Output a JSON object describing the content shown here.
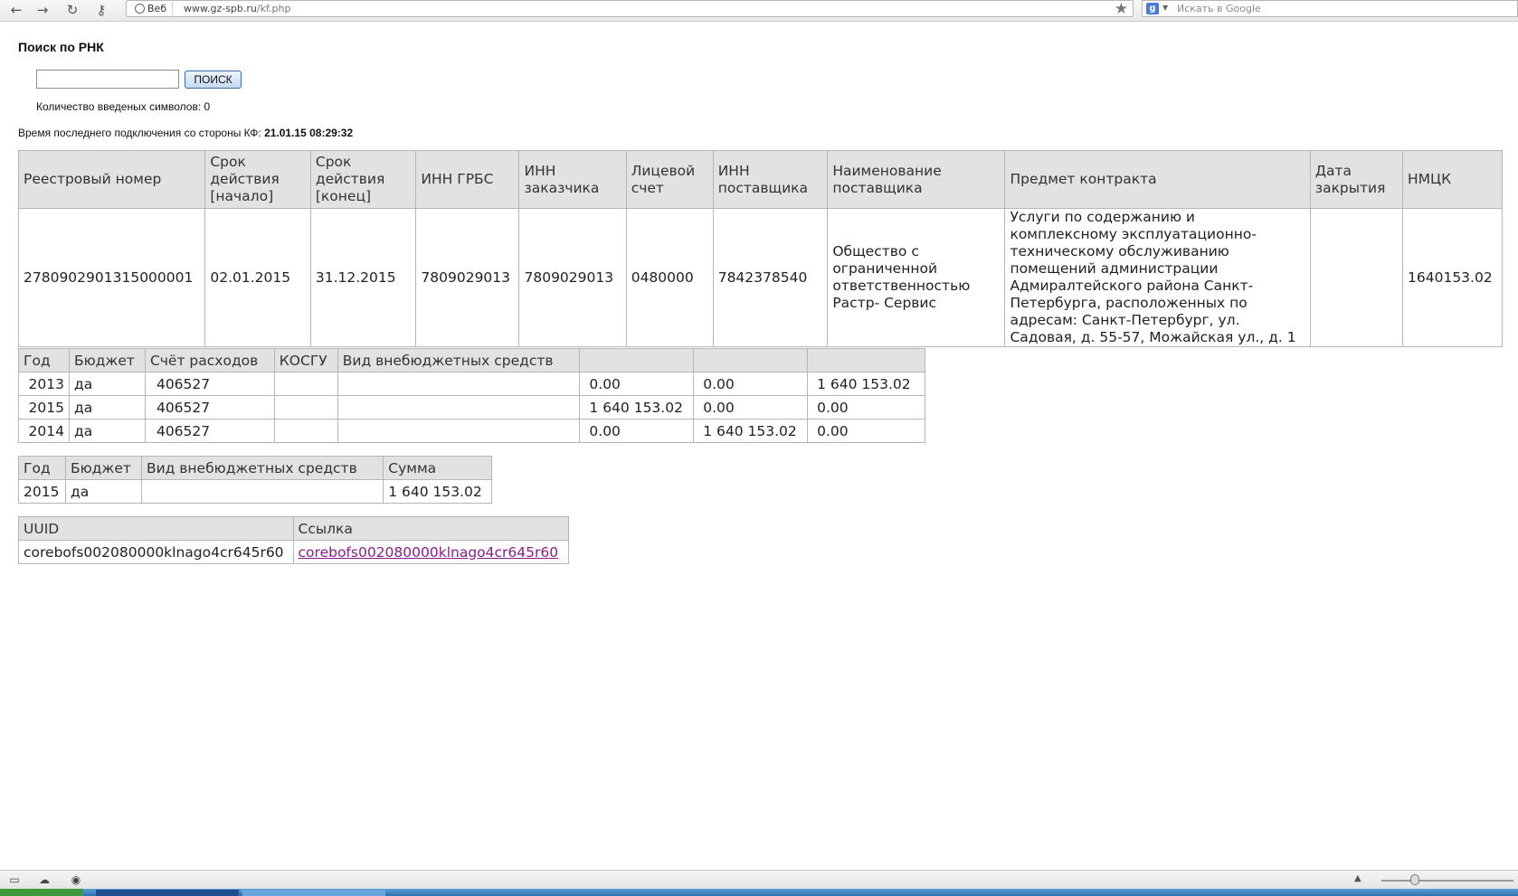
{
  "browser": {
    "back_icon": "←",
    "forward_icon": "→",
    "reload_icon": "↻",
    "key_icon": "⚷",
    "addr_badge": "Веб",
    "url_host": "www.gz-spb.ru",
    "url_path": "/kf.php",
    "star_icon": "★",
    "search_logo": "g",
    "search_placeholder": "Искать в Google"
  },
  "page": {
    "heading": "Поиск по РНК",
    "search_value": "",
    "search_button": "ПОИСК",
    "char_count_label": "Количество введеных символов: 0",
    "last_connection_label": "Время последнего подключения со стороны КФ:",
    "last_connection_value": "21.01.15 08:29:32"
  },
  "contract_table": {
    "headers": [
      "Реестровый номер",
      "Срок действия [начало]",
      "Срок действия [конец]",
      "ИНН ГРБС",
      "ИНН заказчика",
      "Лицевой счет",
      "ИНН поставщика",
      "Наименование поставщика",
      "Предмет контракта",
      "Дата закрытия",
      "НМЦК"
    ],
    "row": [
      "2780902901315000001",
      "02.01.2015",
      "31.12.2015",
      "7809029013",
      "7809029013",
      "0480000",
      "7842378540",
      "Общество с ограниченной ответственностью Растр- Сервис",
      "Услуги по содержанию и комплексному эксплуатационно-техническому обслуживанию помещений администрации Адмиралтейского района Санкт-Петербурга, расположенных по адресам: Санкт-Петербург, ул. Садовая, д. 55-57, Можайская ул., д. 1",
      "",
      "1640153.02"
    ]
  },
  "budget_table": {
    "headers": [
      "Год",
      "Бюджет",
      "Счёт расходов",
      "КОСГУ",
      "Вид внебюджетных средств",
      "",
      "",
      ""
    ],
    "rows": [
      [
        "2013",
        "да",
        "406527",
        "",
        "",
        "0.00",
        "0.00",
        "1 640 153.02"
      ],
      [
        "2015",
        "да",
        "406527",
        "",
        "",
        "1 640 153.02",
        "0.00",
        "0.00"
      ],
      [
        "2014",
        "да",
        "406527",
        "",
        "",
        "0.00",
        "1 640 153.02",
        "0.00"
      ]
    ]
  },
  "sum_table": {
    "headers": [
      "Год",
      "Бюджет",
      "Вид внебюджетных средств",
      "Сумма"
    ],
    "rows": [
      [
        "2015",
        "да",
        "",
        "1 640 153.02"
      ]
    ]
  },
  "uuid_table": {
    "headers": [
      "UUID",
      "Ссылка"
    ],
    "rows": [
      [
        "corebofs002080000klnago4cr645r60",
        "corebofs002080000klnago4cr645r60"
      ]
    ]
  },
  "statusbar": {
    "icon1": "▭",
    "icon2": "☁",
    "icon3": "◉",
    "zoom_up_icon": "▲"
  },
  "colors": {
    "header_bg": "#e2e2e2",
    "link_visited": "#8b1a8b",
    "button_border": "#3b6aa5"
  }
}
